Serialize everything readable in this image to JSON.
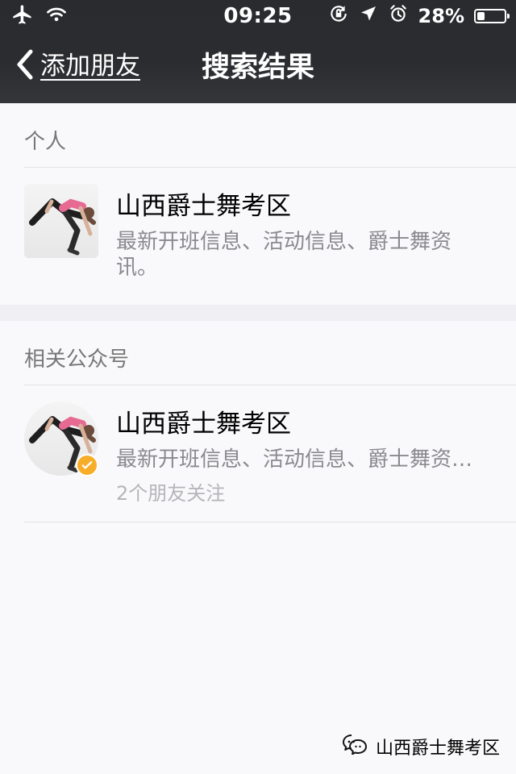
{
  "status_bar": {
    "time": "09:25",
    "battery_percent_text": "28%",
    "battery_level": 0.28,
    "icons_left": [
      "airplane-icon",
      "wifi-icon"
    ],
    "icons_right": [
      "rotation-lock-icon",
      "location-icon",
      "alarm-icon",
      "battery-icon"
    ]
  },
  "nav": {
    "back_label": "添加朋友",
    "title": "搜索结果"
  },
  "sections": {
    "personal": {
      "label": "个人",
      "item": {
        "name": "山西爵士舞考区",
        "desc": "最新开班信息、活动信息、爵士舞资讯。"
      }
    },
    "official_accounts": {
      "label": "相关公众号",
      "item": {
        "name": "山西爵士舞考区",
        "desc": "最新开班信息、活动信息、爵士舞资讯。",
        "meta": "2个朋友关注",
        "verified": true
      }
    }
  },
  "watermark": {
    "text": "山西爵士舞考区",
    "icon": "wechat-icon"
  },
  "colors": {
    "topbar": "#2b2c30",
    "background": "#f9f9fb",
    "divider": "#e2e2e6",
    "section_gap": "#efeff4",
    "secondary_text": "#8a8a8f",
    "verified_badge": "#f7ad27"
  }
}
